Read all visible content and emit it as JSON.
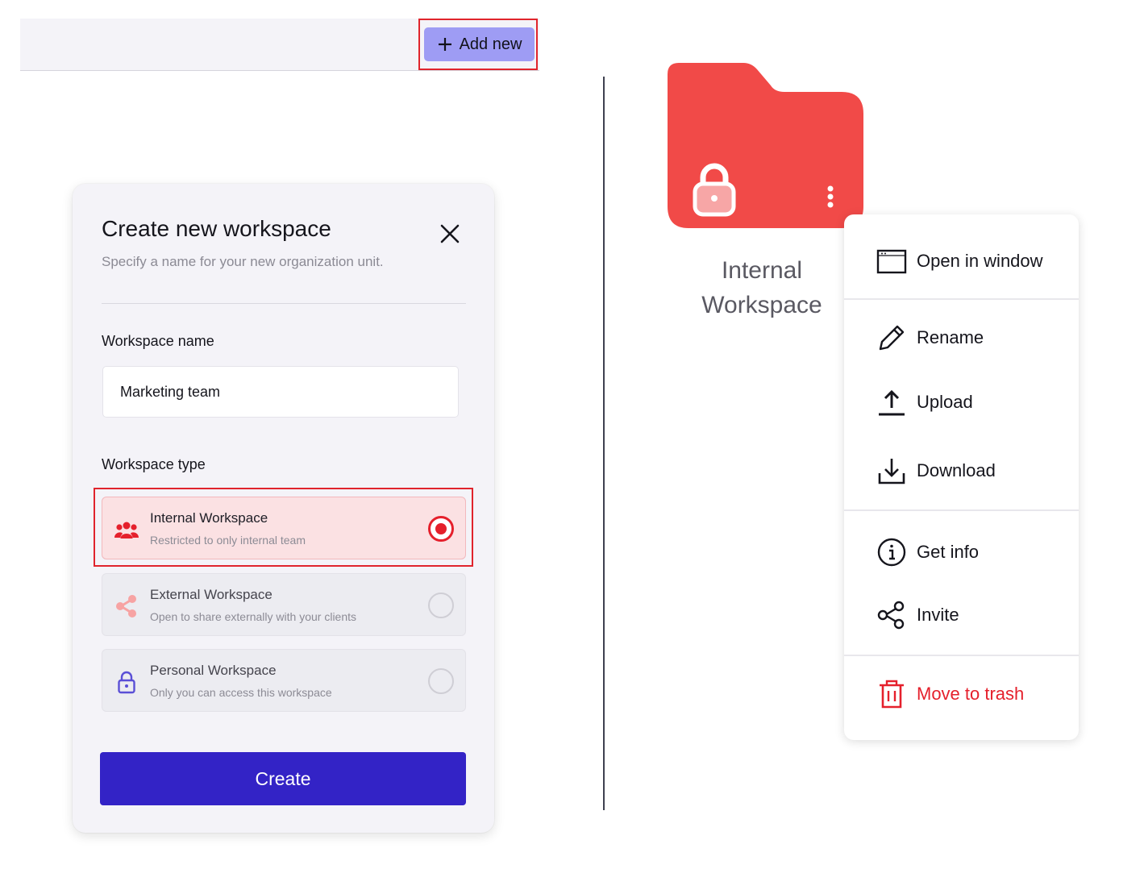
{
  "toolbar": {
    "add_new_label": "Add new"
  },
  "modal": {
    "title": "Create new workspace",
    "subtitle": "Specify a name for your new organization unit.",
    "name_label": "Workspace name",
    "name_value": "Marketing team",
    "type_label": "Workspace type",
    "options": [
      {
        "title": "Internal Workspace",
        "desc": "Restricted to only internal team",
        "selected": true,
        "icon": "people-icon"
      },
      {
        "title": "External Workspace",
        "desc": "Open to share externally with your clients",
        "selected": false,
        "icon": "share-icon"
      },
      {
        "title": "Personal Workspace",
        "desc": "Only you can access this workspace",
        "selected": false,
        "icon": "lock-icon"
      }
    ],
    "create_label": "Create"
  },
  "folder": {
    "name": "Internal Workspace",
    "color": "#f14a48",
    "icon": "lock-icon"
  },
  "context_menu": {
    "items": [
      {
        "label": "Open in window",
        "icon": "window-icon"
      },
      {
        "label": "Rename",
        "icon": "pencil-icon"
      },
      {
        "label": "Upload",
        "icon": "upload-icon"
      },
      {
        "label": "Download",
        "icon": "download-icon"
      },
      {
        "label": "Get info",
        "icon": "info-icon"
      },
      {
        "label": "Invite",
        "icon": "share-icon"
      },
      {
        "label": "Move to trash",
        "icon": "trash-icon",
        "danger": true
      }
    ]
  },
  "colors": {
    "accent": "#3323c6",
    "add_button": "#9e9cf4",
    "danger": "#e5202c",
    "highlight": "#e0242c"
  }
}
